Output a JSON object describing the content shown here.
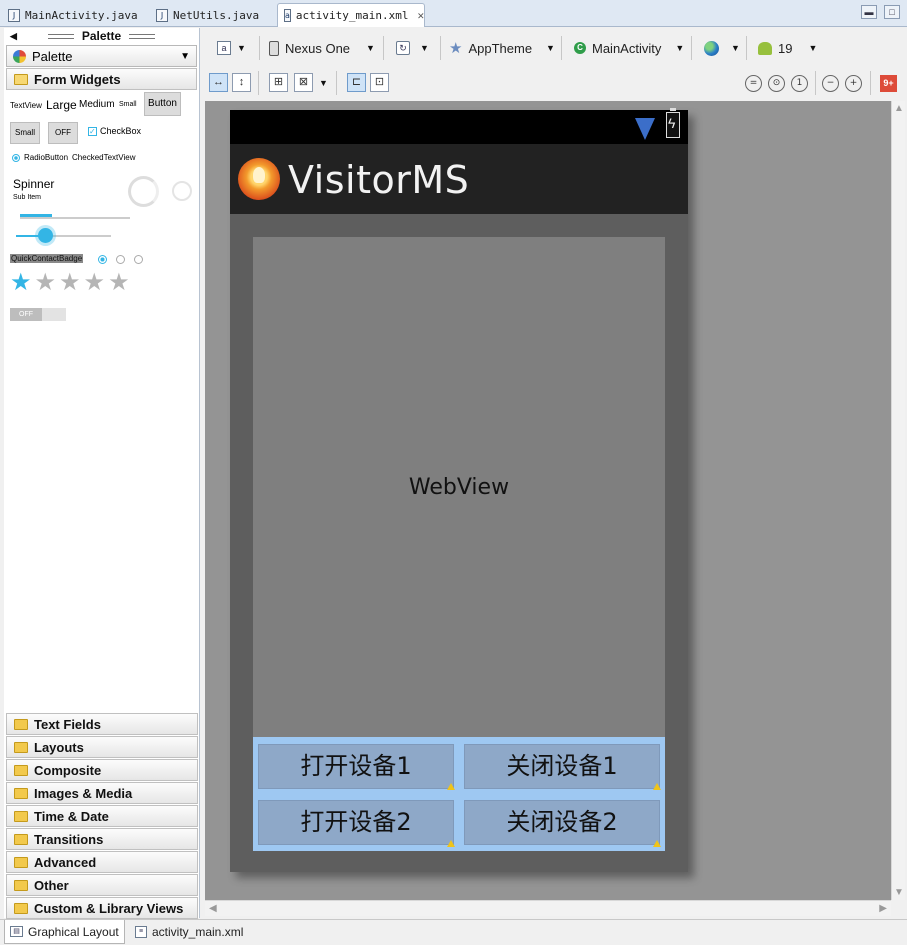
{
  "editor_tabs": [
    {
      "label": "MainActivity.java",
      "icon": "java-file-icon"
    },
    {
      "label": "NetUtils.java",
      "icon": "java-file-icon"
    },
    {
      "label": "activity_main.xml",
      "icon": "xml-layout-file-icon",
      "active": true
    }
  ],
  "palette": {
    "title": "Palette",
    "selector": "Palette",
    "open_section": "Form Widgets",
    "widgets": {
      "textview_small": "TextView",
      "large": "Large",
      "medium": "Medium",
      "small": "Small",
      "button": "Button",
      "small_button": "Small",
      "toggle": "OFF",
      "checkbox": "CheckBox",
      "radio": "RadioButton",
      "checked_text": "CheckedTextView",
      "spinner": "Spinner",
      "spinner_sub": "Sub Item",
      "quick_contact": "QuickContactBadge",
      "switch": "OFF",
      "rating_filled": 1,
      "rating_total": 5
    },
    "sections": [
      "Text Fields",
      "Layouts",
      "Composite",
      "Images & Media",
      "Time & Date",
      "Transitions",
      "Advanced",
      "Other",
      "Custom & Library Views"
    ]
  },
  "toolbar": {
    "device": "Nexus One",
    "theme": "AppTheme",
    "activity": "MainActivity",
    "api_level": "19",
    "gplus_badge": "9+"
  },
  "preview": {
    "app_title": "VisitorMS",
    "webview_label": "WebView",
    "buttons": [
      "打开设备1",
      "关闭设备1",
      "打开设备2",
      "关闭设备2"
    ]
  },
  "bottom_tabs": [
    "Graphical Layout",
    "activity_main.xml"
  ],
  "colors": {
    "accent_blue": "#33b5e5",
    "canvas_gray": "#949494",
    "button_area": "#9ec8f2"
  }
}
